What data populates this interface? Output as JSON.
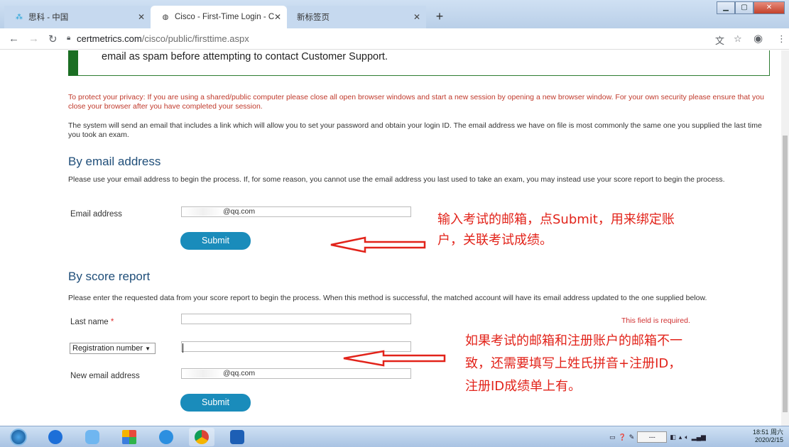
{
  "browser": {
    "tabs": [
      {
        "label": "思科 - 中国",
        "active": false
      },
      {
        "label": "Cisco - First-Time Login - Cert",
        "active": true
      },
      {
        "label": "新标签页",
        "active": false
      }
    ],
    "url_host": "certmetrics.com",
    "url_path": "/cisco/public/firsttime.aspx"
  },
  "page": {
    "notice_text": "email as spam before attempting to contact Customer Support.",
    "privacy_text": "To protect your privacy: If you are using a shared/public computer please close all open browser windows and start a new session by opening a new browser window. For your own security please ensure that you close your browser after you have completed your session.",
    "system_text": "The system will send an email that includes a link which will allow you to set your password and obtain your login ID. The email address we have on file is most commonly the same one you supplied the last time you took an exam.",
    "email_section": {
      "heading": "By email address",
      "intro": "Please use your email address to begin the process. If, for some reason, you cannot use the email address you last used to take an exam, you may instead use your score report to begin the process.",
      "email_label": "Email address",
      "email_value": "@qq.com",
      "submit_label": "Submit"
    },
    "score_section": {
      "heading": "By score report",
      "intro": "Please enter the requested data from your score report to begin the process. When this method is successful, the matched account will have its email address updated to the one supplied below.",
      "last_name_label": "Last name",
      "required_marker": "*",
      "required_message": "This field is required.",
      "id_type_selected": "Registration number",
      "new_email_label": "New email address",
      "new_email_value": "@qq.com",
      "submit_label": "Submit"
    },
    "annotations": {
      "note1_line1": "输入考试的邮箱，点Submit，用来绑定账",
      "note1_line2": "户，关联考试成绩。",
      "note2_line1": "如果考试的邮箱和注册账户的邮箱不一",
      "note2_line2": "致，还需要填写上姓氏拼音+注册ID，",
      "note2_line3": "注册ID成绩单上有。"
    }
  },
  "taskbar": {
    "traybox": "---",
    "clock_time": "18:51 周六",
    "clock_date": "2020/2/15"
  },
  "colors": {
    "heading": "#1f4e79",
    "submit": "#1a8cbb",
    "privacy": "#c0392b",
    "annotation": "#e2231a",
    "notice_bar": "#1b6e23"
  }
}
